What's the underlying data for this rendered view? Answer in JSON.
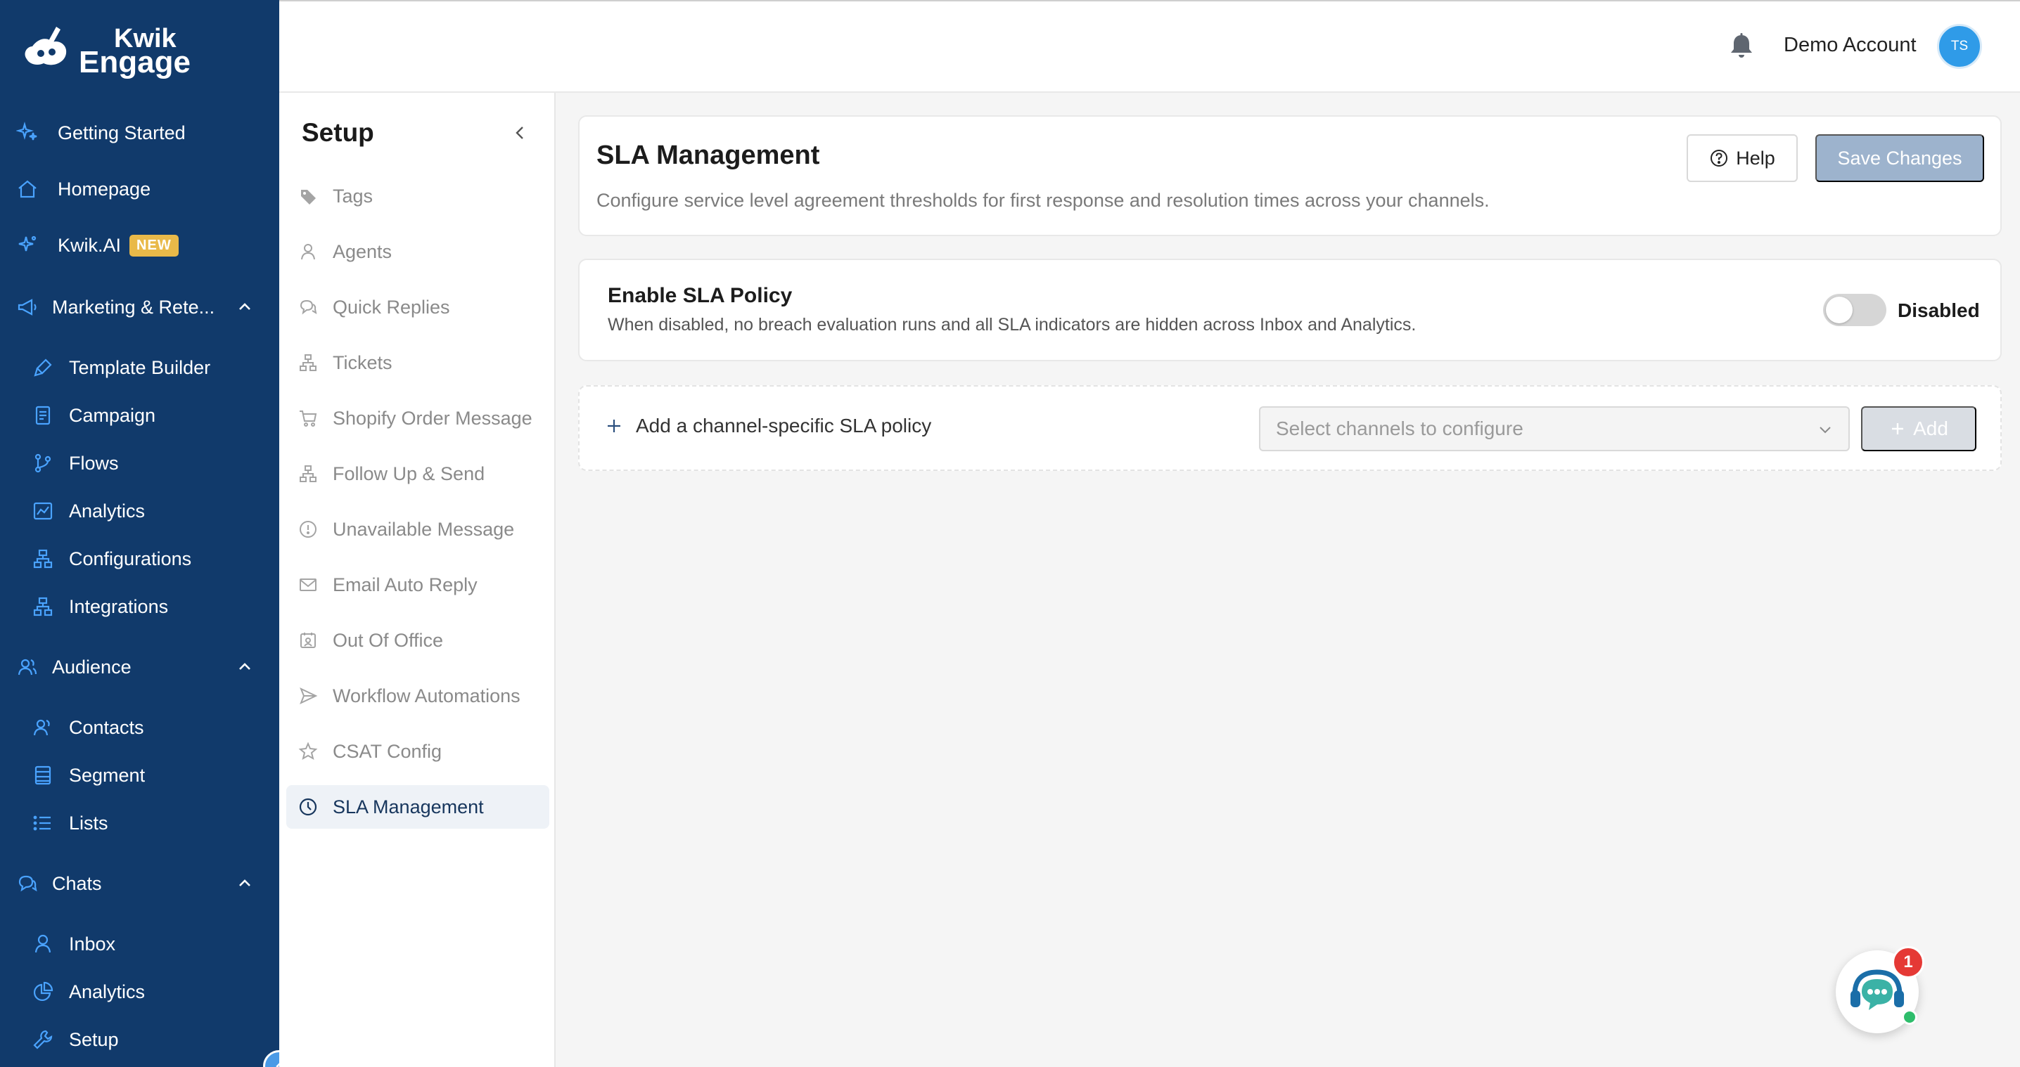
{
  "brand": {
    "line1": "Kwik",
    "line2": "Engage"
  },
  "sidebar": {
    "top": [
      {
        "label": "Getting Started",
        "icon": "sparkle-icon"
      },
      {
        "label": "Homepage",
        "icon": "home-icon"
      },
      {
        "label": "Kwik.AI",
        "icon": "ai-sparkle-icon",
        "badge": "NEW"
      }
    ],
    "marketing": {
      "label": "Marketing & Rete...",
      "items": [
        {
          "label": "Template Builder"
        },
        {
          "label": "Campaign"
        },
        {
          "label": "Flows"
        },
        {
          "label": "Analytics"
        },
        {
          "label": "Configurations"
        },
        {
          "label": "Integrations"
        }
      ]
    },
    "audience": {
      "label": "Audience",
      "items": [
        {
          "label": "Contacts"
        },
        {
          "label": "Segment"
        },
        {
          "label": "Lists"
        }
      ]
    },
    "chats": {
      "label": "Chats",
      "items": [
        {
          "label": "Inbox"
        },
        {
          "label": "Analytics"
        },
        {
          "label": "Setup"
        }
      ]
    }
  },
  "header": {
    "account": "Demo Account",
    "avatar_initials": "TS"
  },
  "setup": {
    "title": "Setup",
    "items": [
      {
        "label": "Tags"
      },
      {
        "label": "Agents"
      },
      {
        "label": "Quick Replies"
      },
      {
        "label": "Tickets"
      },
      {
        "label": "Shopify Order Message"
      },
      {
        "label": "Follow Up & Send"
      },
      {
        "label": "Unavailable Message"
      },
      {
        "label": "Email Auto Reply"
      },
      {
        "label": "Out Of Office"
      },
      {
        "label": "Workflow Automations"
      },
      {
        "label": "CSAT Config"
      },
      {
        "label": "SLA Management",
        "active": true
      }
    ]
  },
  "main": {
    "title": "SLA Management",
    "description": "Configure service level agreement thresholds for first response and resolution times across your channels.",
    "help_label": "Help",
    "save_label": "Save Changes",
    "sla": {
      "title": "Enable SLA Policy",
      "description": "When disabled, no breach evaluation runs and all SLA indicators are hidden across Inbox and Analytics.",
      "toggle_state": "Disabled"
    },
    "add_policy": {
      "label": "Add a channel-specific SLA policy",
      "select_placeholder": "Select channels to configure",
      "add_label": "Add"
    }
  },
  "chat_widget": {
    "unread": "1"
  },
  "colors": {
    "sidebar_bg": "#113a6b",
    "accent": "#2f9be8",
    "badge_new": "#e9b949",
    "save_btn": "#9db3cd"
  }
}
